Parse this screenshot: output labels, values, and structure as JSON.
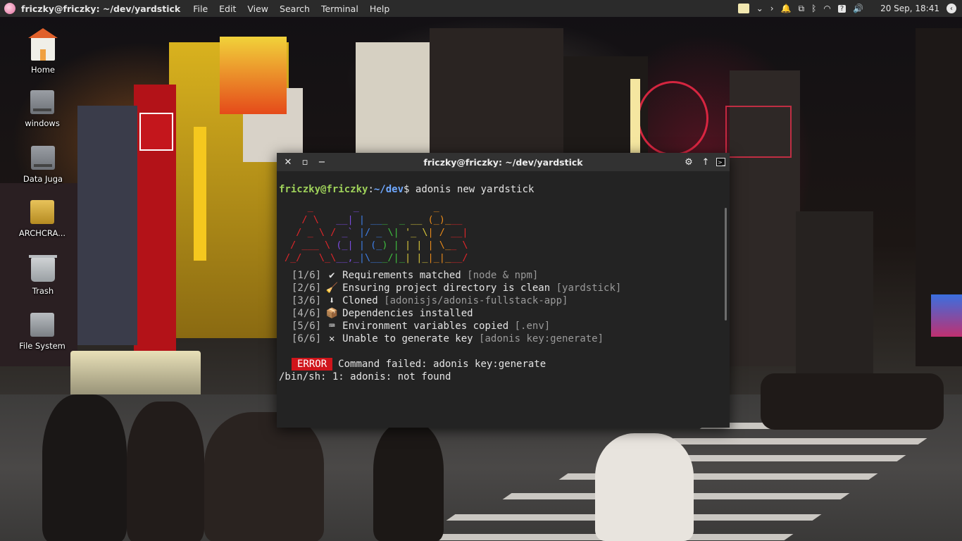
{
  "panel": {
    "window_title": "friczky@friczky: ~/dev/yardstick",
    "menus": [
      "File",
      "Edit",
      "View",
      "Search",
      "Terminal",
      "Help"
    ],
    "tray": {
      "battery_label": "?",
      "datetime": "20 Sep, 18:41",
      "icons": [
        "notes-icon",
        "chevron-down-icon",
        "chevron-right-icon",
        "notification-bell-icon",
        "screenshot-icon",
        "bluetooth-icon",
        "wifi-icon",
        "battery-icon",
        "volume-icon",
        "back-icon"
      ]
    }
  },
  "desktop_icons": [
    {
      "label": "Home",
      "icon": "home-folder-icon"
    },
    {
      "label": "windows",
      "icon": "drive-icon"
    },
    {
      "label": "Data Juga",
      "icon": "drive-icon"
    },
    {
      "label": "ARCHCRA...",
      "icon": "dvd-drive-icon"
    },
    {
      "label": "Trash",
      "icon": "trash-icon"
    },
    {
      "label": "File System",
      "icon": "filesystem-icon"
    }
  ],
  "terminal": {
    "title": "friczky@friczky: ~/dev/yardstick",
    "prompt_user": "friczky@friczky",
    "prompt_path": "~/dev",
    "command": "adonis new yardstick",
    "ascii_art_lines": [
      "    _       _             _      ",
      "   / \\   __| | ___  _ __ (_)___  ",
      "  / _ \\ / _` |/ _ \\| '_ \\| / __| ",
      " / ___ \\ (_| | (_) | | | | \\__ \\ ",
      "/_/   \\_\\__,_|\\___/|_| |_|_|___/ "
    ],
    "ascii_colors": [
      "#e0262a",
      "#e0262a",
      "#7a4be0",
      "#3f7fe8",
      "#3fbf3f",
      "#d8c63a",
      "#e88a1a",
      "#e0262a"
    ],
    "steps": [
      {
        "num": "[1/6]",
        "icon": "✔",
        "text": "Requirements matched",
        "detail": "[node & npm]"
      },
      {
        "num": "[2/6]",
        "icon": "🧹",
        "text": "Ensuring project directory is clean",
        "detail": "[yardstick]"
      },
      {
        "num": "[3/6]",
        "icon": "⬇",
        "text": "Cloned",
        "detail": "[adonisjs/adonis-fullstack-app]"
      },
      {
        "num": "[4/6]",
        "icon": "📦",
        "text": "Dependencies installed",
        "detail": ""
      },
      {
        "num": "[5/6]",
        "icon": "⌨",
        "text": "Environment variables copied",
        "detail": "[.env]"
      },
      {
        "num": "[6/6]",
        "icon": "✕",
        "text": "Unable to generate key",
        "detail": "[adonis key:generate]"
      }
    ],
    "error_badge": "ERROR",
    "error_message": "Command failed: adonis key:generate",
    "shell_error": "/bin/sh: 1: adonis: not found"
  }
}
